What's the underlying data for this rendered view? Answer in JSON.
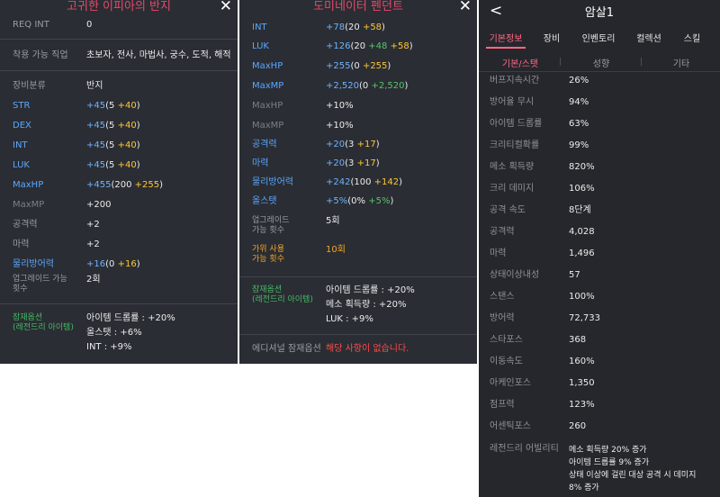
{
  "panel1": {
    "title": "고귀한 이피아의 반지",
    "close": "✕",
    "rows": [
      {
        "label": "REQ INT",
        "value": "0"
      },
      {
        "label": "착용 가능 직업",
        "value": "초보자, 전사, 마법사, 궁수, 도적, 해적"
      },
      {
        "label": "장비분류",
        "value": "반지"
      },
      {
        "label": "STR",
        "total": "+45",
        "base": "5",
        "bonus": "+40"
      },
      {
        "label": "DEX",
        "total": "+45",
        "base": "5",
        "bonus": "+40"
      },
      {
        "label": "INT",
        "total": "+45",
        "base": "5",
        "bonus": "+40"
      },
      {
        "label": "LUK",
        "total": "+45",
        "base": "5",
        "bonus": "+40"
      },
      {
        "label": "MaxHP",
        "total": "+455",
        "base": "200",
        "bonus": "+255"
      },
      {
        "label": "MaxMP",
        "value": "+200"
      },
      {
        "label": "공격력",
        "value": "+2"
      },
      {
        "label": "마력",
        "value": "+2"
      },
      {
        "label": "물리방어력",
        "total": "+16",
        "base": "0",
        "bonus": "+16"
      },
      {
        "label": "업그레이드 가능 횟수",
        "value": "2회"
      }
    ],
    "potential_label": "잠재옵션\n(레전드리 아이템)",
    "potential_label_1": "잠재옵션",
    "potential_label_2": "(레전드리 아이템)",
    "potential_lines": [
      "아이템 드롭률 : +20%",
      "올스탯 : +6%",
      "INT : +9%"
    ]
  },
  "panel2": {
    "title": "도미네이터 펜던트",
    "close": "✕",
    "rows": [
      {
        "label": "INT",
        "total": "+78",
        "base": "20",
        "bonus": "+58"
      },
      {
        "label": "LUK",
        "total": "+126",
        "base": "20",
        "extra": "+48",
        "bonus": "+58"
      },
      {
        "label": "MaxHP",
        "total": "+255",
        "base": "0",
        "bonus": "+255"
      },
      {
        "label": "MaxMP",
        "total": "+2,520",
        "base": "0",
        "extra": "+2,520"
      },
      {
        "label": "MaxHP",
        "value": "+10%"
      },
      {
        "label": "MaxMP",
        "value": "+10%"
      },
      {
        "label": "공격력",
        "total": "+20",
        "base": "3",
        "bonus": "+17"
      },
      {
        "label": "마력",
        "total": "+20",
        "base": "3",
        "bonus": "+17"
      },
      {
        "label": "물리방어력",
        "total": "+242",
        "base": "100",
        "bonus": "+142"
      },
      {
        "label": "올스탯",
        "total": "+5%",
        "base": "0%",
        "extra": "+5%"
      },
      {
        "label1": "업그레이드",
        "label2": "가능 횟수",
        "value": "5회"
      },
      {
        "label1": "가위 사용",
        "label2": "가능 횟수",
        "value": "10회"
      }
    ],
    "potential_label_1": "잠재옵션",
    "potential_label_2": "(레전드리 아이템)",
    "potential_lines": [
      "아이템 드롭률 : +20%",
      "메소 획득량 : +20%",
      "LUK : +9%"
    ],
    "additional_label": "에디셔널 잠재옵션",
    "additional_value": "해당 사항이 없습니다."
  },
  "panel3": {
    "back": "<",
    "name": "암살1",
    "tabs": [
      "기본정보",
      "장비",
      "인벤토리",
      "컬렉션",
      "스킬"
    ],
    "subtabs": [
      "기본/스탯",
      "성향",
      "기타"
    ],
    "stats": [
      {
        "label": "버프지속시간",
        "value": "26%"
      },
      {
        "label": "방어율 무시",
        "value": "94%"
      },
      {
        "label": "아이템 드롭률",
        "value": "63%"
      },
      {
        "label": "크리티컬확률",
        "value": "99%"
      },
      {
        "label": "메소 획득량",
        "value": "820%"
      },
      {
        "label": "크리 데미지",
        "value": "106%"
      },
      {
        "label": "공격 속도",
        "value": "8단계"
      },
      {
        "label": "공격력",
        "value": "4,028"
      },
      {
        "label": "마력",
        "value": "1,496"
      },
      {
        "label": "상태이상내성",
        "value": "57"
      },
      {
        "label": "스탠스",
        "value": "100%"
      },
      {
        "label": "방어력",
        "value": "72,733"
      },
      {
        "label": "스타포스",
        "value": "368"
      },
      {
        "label": "이동속도",
        "value": "160%"
      },
      {
        "label": "아케인포스",
        "value": "1,350"
      },
      {
        "label": "점프력",
        "value": "123%"
      },
      {
        "label": "어센틱포스",
        "value": "260"
      }
    ],
    "legendary_label": "레전드리 어빌리티",
    "legendary_lines": [
      "메소 획득량 20% 증가",
      "아이템 드롭률 9% 증가",
      "상태 이상에 걸린 대상 공격 시 데미지",
      "8% 증가"
    ]
  }
}
